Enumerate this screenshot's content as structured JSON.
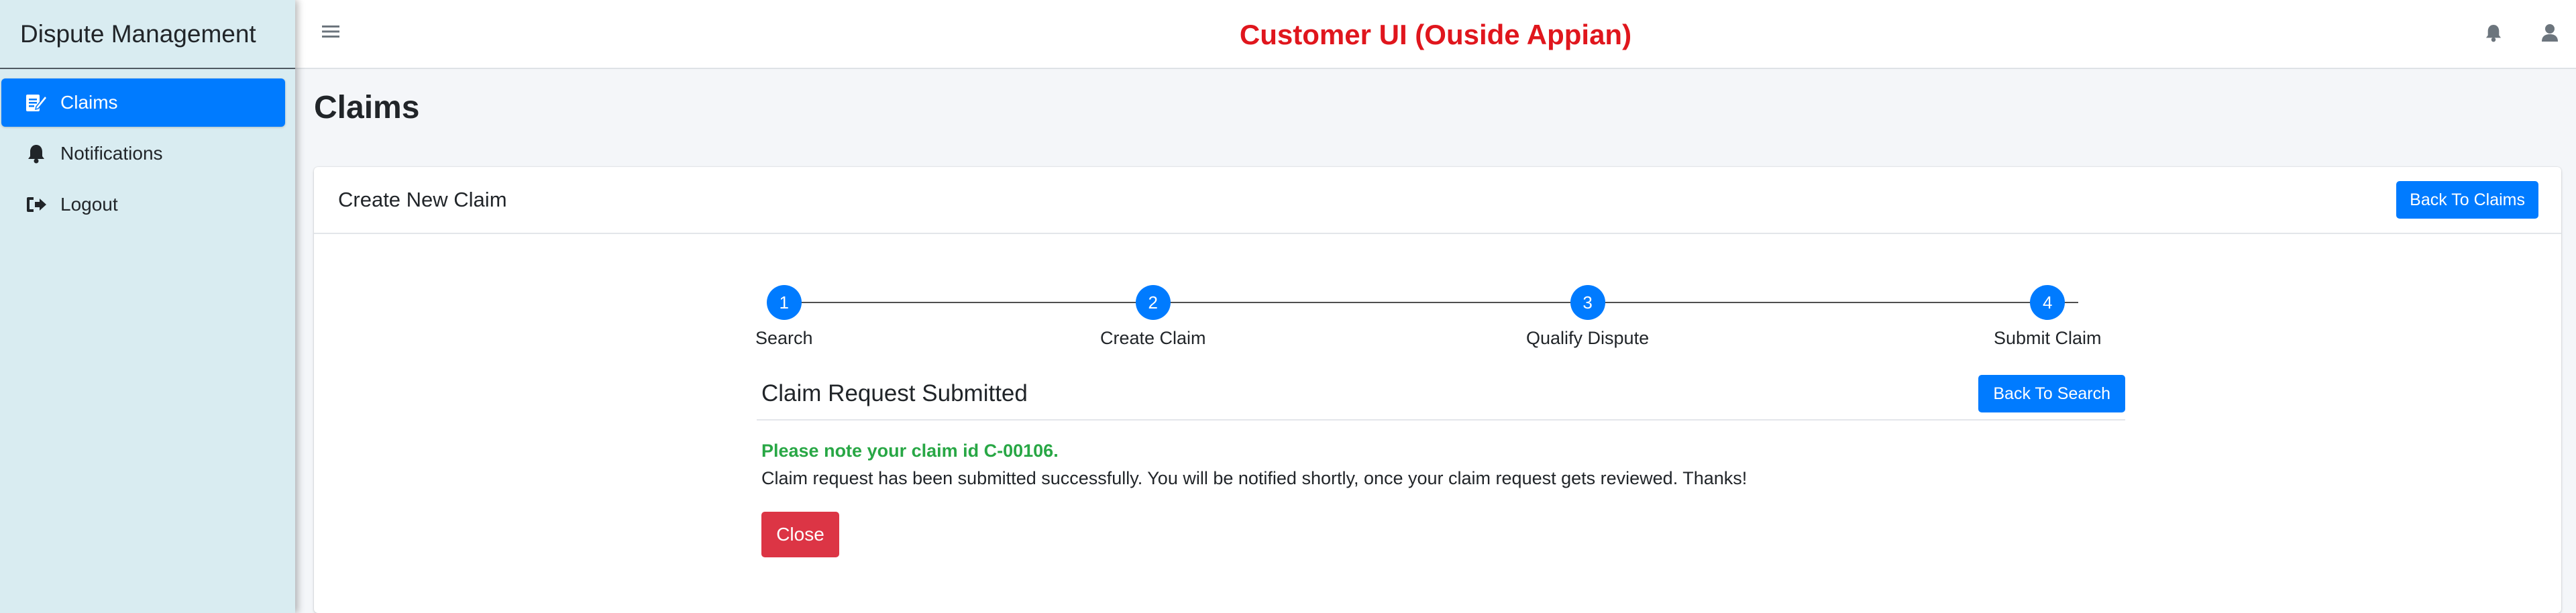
{
  "sidebar": {
    "brand": "Dispute Management",
    "items": [
      {
        "label": "Claims",
        "icon": "edit-document-icon"
      },
      {
        "label": "Notifications",
        "icon": "bell-icon"
      },
      {
        "label": "Logout",
        "icon": "sign-out-icon"
      }
    ]
  },
  "header": {
    "title": "Customer UI (Ouside Appian)",
    "title_color": "#e0161d"
  },
  "page": {
    "title": "Claims"
  },
  "card": {
    "title": "Create New Claim",
    "back_to_claims_label": "Back To Claims"
  },
  "stepper": {
    "steps": [
      {
        "number": "1",
        "label": "Search"
      },
      {
        "number": "2",
        "label": "Create Claim"
      },
      {
        "number": "3",
        "label": "Qualify Dispute"
      },
      {
        "number": "4",
        "label": "Submit Claim"
      }
    ]
  },
  "result": {
    "title": "Claim Request Submitted",
    "back_to_search_label": "Back To Search",
    "note": "Please note your claim id C-00106.",
    "message": "Claim request has been submitted successfully. You will be notified shortly, once your claim request gets reviewed. Thanks!",
    "close_label": "Close"
  },
  "colors": {
    "primary": "#007bff",
    "success": "#28a745",
    "danger": "#dc3545",
    "sidebar_bg": "#d9ecf1"
  }
}
